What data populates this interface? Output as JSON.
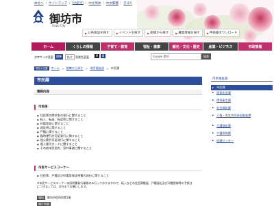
{
  "header": {
    "util_links": [
      "本文へ",
      "サイトマップ",
      "English",
      "中文简体",
      "中文繁體",
      "한국어"
    ],
    "logo": {
      "name": "御坊市",
      "sub": "Gobo City"
    },
    "quick_nav": [
      "公共施設を探す",
      "イベントを探す",
      "組織から探す",
      "募集情報を探す",
      "申請書ダウンロード"
    ]
  },
  "global_nav": [
    "ホーム",
    "くらしの情報",
    "子育て・教育",
    "福祉・健康",
    "観光・文化・歴史",
    "産業・ビジネス",
    "市政情報"
  ],
  "tools": {
    "font_label": "文字サイズ変更",
    "font_standard": "標準",
    "font_large": "拡大",
    "bg_label": "背景色変更",
    "bg_black": "黒",
    "bg_blue": "青",
    "search_placeholder": "Google 提供",
    "search_button": "検索"
  },
  "breadcrumb": {
    "here_badge": "現在の位置",
    "items": [
      "ホーム",
      "組織から探す",
      "市民福祉部"
    ],
    "current": "市民課"
  },
  "main": {
    "title": "市民課",
    "gyomu_heading": "業務内容",
    "section_title": "市民係",
    "duties": [
      "住民票の謄抄本の発行に関すること",
      "転入、転出、転居等に関すること",
      "印鑑登録に関すること",
      "諸証明に関すること",
      "戸籍に関すること",
      "臨時運行許可証発行に関すること",
      "埋火葬許可証発行に関すること",
      "個人番号カードに関すること",
      "その他市民案内、窓口事務に関すること"
    ],
    "service_title": "市民サービスコーナー",
    "service_items": [
      "住民票、戸籍及び印鑑登録証明書の発行に関すること"
    ],
    "service_note": "※市民サービスコーナーは証明書発行業務のみ行っておりますので、転入などの住民異動届、戸籍届出及び印鑑登録等の手続きにつきましては、本庁までお願いします。",
    "place_label": "場所",
    "place_value": "御坊市役所別館1階",
    "hours_label": "開庁時間"
  },
  "sidebar": {
    "title": "市民福祉部",
    "items": [
      "市民課",
      "国保年金課",
      "環境衛生課",
      "社会福祉課",
      "人権・男女共同参画推進課",
      "介護福祉課",
      "介護保険課",
      "保健センター"
    ],
    "active_index": 0
  },
  "colors": {
    "nav_home": "#b51a5c",
    "nav_dark": "#444444",
    "page_title_bg": "#2d4f9e",
    "accent": "#c0306a"
  }
}
